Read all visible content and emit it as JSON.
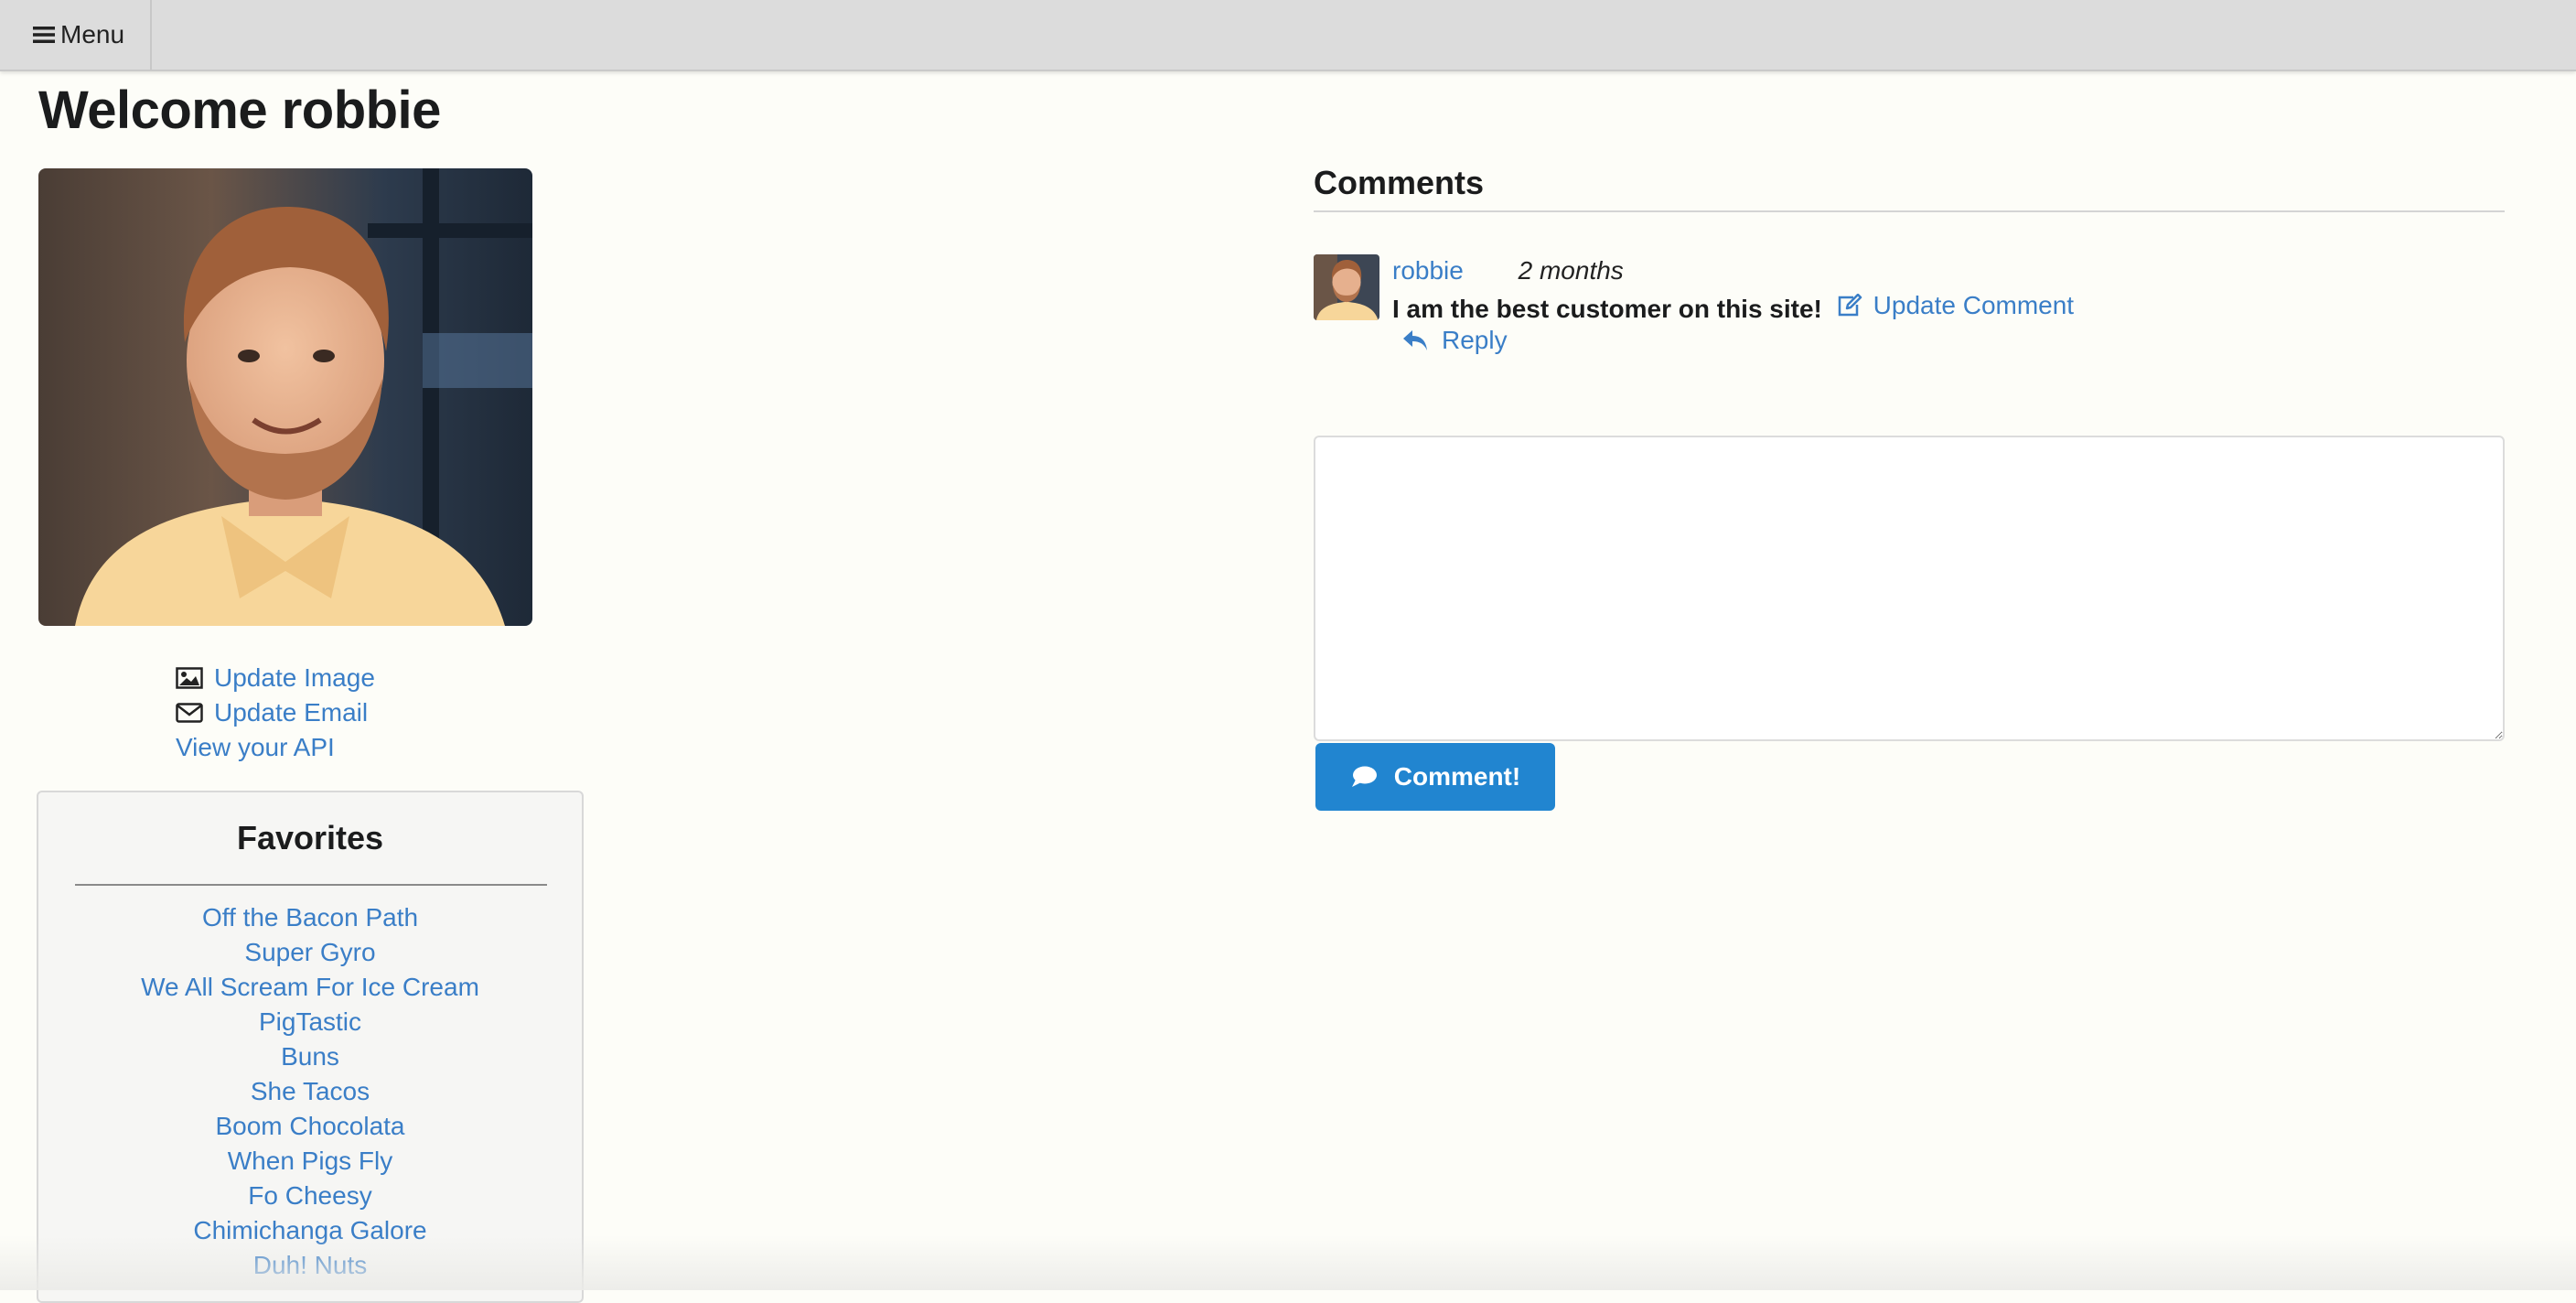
{
  "nav": {
    "menu_label": "Menu"
  },
  "profile": {
    "welcome": "Welcome robbie",
    "links": {
      "update_image": "Update Image",
      "update_email": "Update Email",
      "view_api": "View your API"
    }
  },
  "favorites": {
    "title": "Favorites",
    "items": [
      "Off the Bacon Path",
      "Super Gyro",
      "We All Scream For Ice Cream",
      "PigTastic",
      "Buns",
      "She Tacos",
      "Boom Chocolata",
      "When Pigs Fly",
      "Fo Cheesy",
      "Chimichanga Galore",
      "Duh! Nuts"
    ]
  },
  "comments": {
    "title": "Comments",
    "items": [
      {
        "author": "robbie",
        "date": "2 months",
        "text": "I am the best customer on this site!",
        "update_label": "Update Comment",
        "reply_label": "Reply"
      }
    ],
    "textarea_value": "",
    "submit_label": "Comment!"
  },
  "colors": {
    "link": "#3a7ec7",
    "primary_button": "#2185d0",
    "background": "#fdfdf8",
    "topbar": "#dcdcdc"
  }
}
